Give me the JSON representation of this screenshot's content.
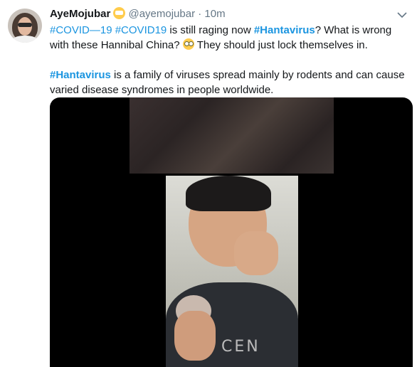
{
  "tweet": {
    "author_name": "AyeMojubar",
    "author_handle": "@ayemojubar",
    "separator": "·",
    "time": "10m",
    "line1": {
      "tag1": "#COVID—19",
      "tag2": "#COVID19",
      "text1": " is still raging now ",
      "tag3": "#Hantavirus",
      "text2": "? What is wrong with these Hannibal China? ",
      "text3": " They should just lock themselves in."
    },
    "line2": {
      "tag": "#Hantavirus",
      "text": " is a family of viruses spread mainly by rodents and can cause varied disease syndromes in people worldwide."
    },
    "media": {
      "shirt_text": "CEN"
    }
  },
  "icons": {
    "name_emoji": "face-with-medical-mask-icon",
    "flushed_emoji": "flushed-face-icon",
    "more": "chevron-down-icon"
  },
  "colors": {
    "link": "#1b95e0",
    "secondary_text": "#657786",
    "primary_text": "#14171a"
  }
}
